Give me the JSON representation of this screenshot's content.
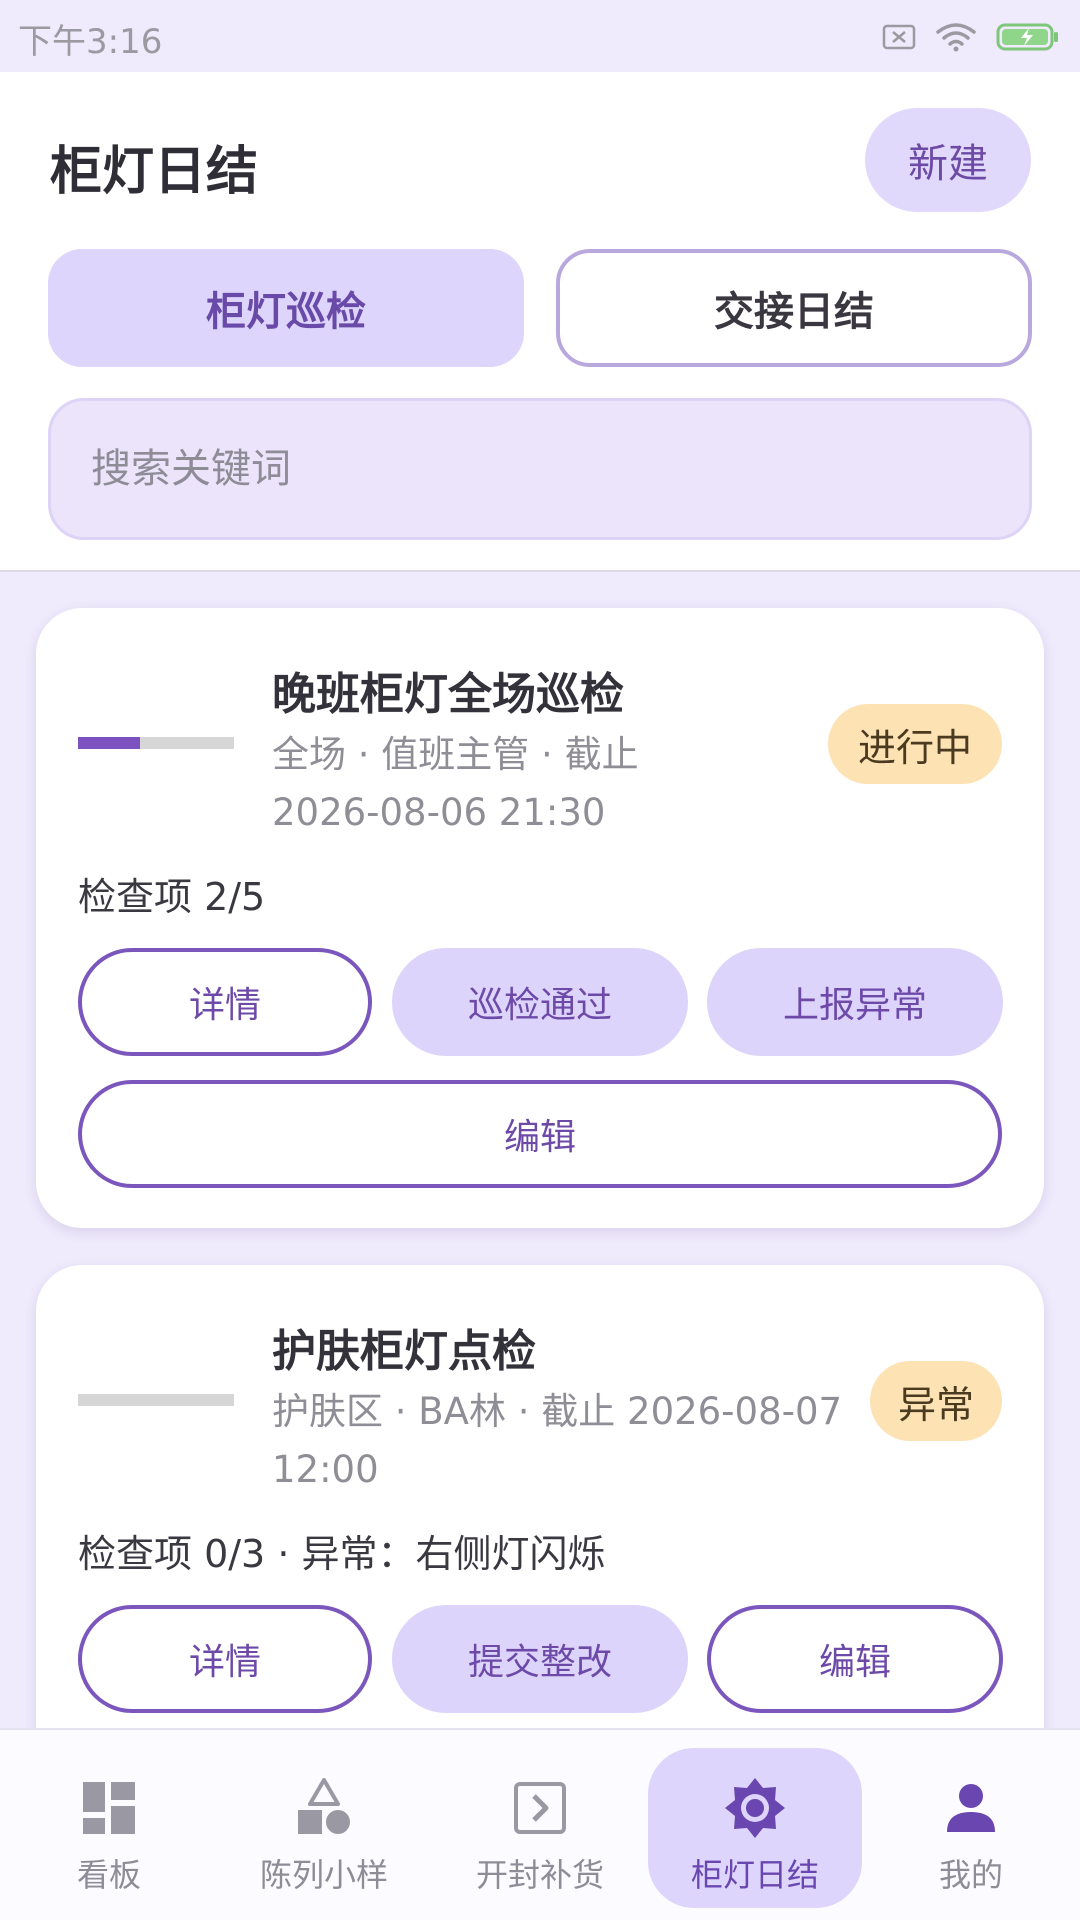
{
  "status_bar": {
    "time": "下午3:16",
    "icons": [
      "sim-none-icon",
      "wifi-icon",
      "battery-charging-icon"
    ]
  },
  "header": {
    "title": "柜灯日结",
    "new_button": "新建",
    "tabs": [
      {
        "label": "柜灯巡检",
        "active": true
      },
      {
        "label": "交接日结",
        "active": false
      }
    ],
    "search": {
      "placeholder": "搜索关键词",
      "value": ""
    }
  },
  "cards": [
    {
      "title": "晚班柜灯全场巡检",
      "meta_line1": "全场 · 值班主管 · 截止",
      "meta_line2": "2026-08-06 21:30",
      "status": "进行中",
      "progress": 0.4,
      "info": "检查项 2/5",
      "buttons": [
        "详情",
        "巡检通过",
        "上报异常"
      ],
      "wide_button": "编辑"
    },
    {
      "title": "护肤柜灯点检",
      "meta_line1": "护肤区 · BA林 · 截止 2026-08-07",
      "meta_line2": "12:00",
      "status": "异常",
      "progress": 0,
      "info": "检查项 0/3 · 异常：右侧灯闪烁",
      "buttons": [
        "详情",
        "提交整改",
        "编辑"
      ]
    }
  ],
  "bottom_nav": [
    {
      "label": "看板",
      "icon": "dashboard-icon",
      "active": false
    },
    {
      "label": "陈列小样",
      "icon": "shapes-icon",
      "active": false
    },
    {
      "label": "开封补货",
      "icon": "open-box-icon",
      "active": false
    },
    {
      "label": "柜灯日结",
      "icon": "light-sun-icon",
      "active": true
    },
    {
      "label": "我的",
      "icon": "person-icon",
      "active": false
    }
  ],
  "colors": {
    "accent": "#6a46b0",
    "accent_light": "#ddd5fb",
    "background": "#efeafc",
    "badge": "#fde2b4",
    "progress_fill": "#7b52c0"
  }
}
